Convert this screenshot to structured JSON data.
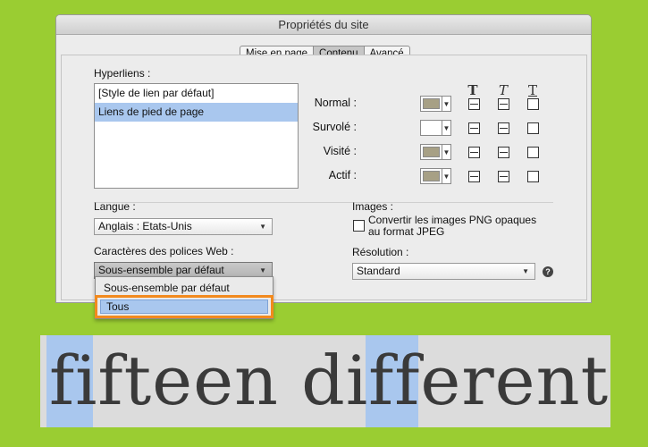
{
  "dialog": {
    "title": "Propriétés du site",
    "tabs": [
      {
        "label": "Mise en page",
        "active": false
      },
      {
        "label": "Contenu",
        "active": true
      },
      {
        "label": "Avancé",
        "active": false
      }
    ]
  },
  "hyperlinks": {
    "label": "Hyperliens :",
    "items": [
      {
        "label": "[Style de lien par défaut]",
        "selected": false
      },
      {
        "label": "Liens de pied de page",
        "selected": true
      }
    ]
  },
  "format_headers": [
    "T",
    "T",
    "T"
  ],
  "states": [
    {
      "label": "Normal :",
      "color": "#a7a085"
    },
    {
      "label": "Survolé :",
      "color": "#ffffff"
    },
    {
      "label": "Visité :",
      "color": "#a7a085"
    },
    {
      "label": "Actif :",
      "color": "#a7a085"
    }
  ],
  "language": {
    "label": "Langue :",
    "value": "Anglais : Etats-Unis"
  },
  "web_fonts": {
    "label": "Caractères des polices Web :",
    "value": "Sous-ensemble par défaut",
    "options": [
      "Sous-ensemble par défaut",
      "Tous"
    ],
    "highlighted": "Tous"
  },
  "images": {
    "label": "Images :",
    "checkbox_label_line1": "Convertir les images PNG opaques",
    "checkbox_label_line2": "au format JPEG",
    "checked": false
  },
  "resolution": {
    "label": "Résolution :",
    "value": "Standard",
    "help_icon": "?"
  },
  "sample_text": "fifteen different",
  "colors": {
    "background": "#9acd32",
    "highlight": "#f28a1e",
    "selection": "#a9c7ee"
  }
}
